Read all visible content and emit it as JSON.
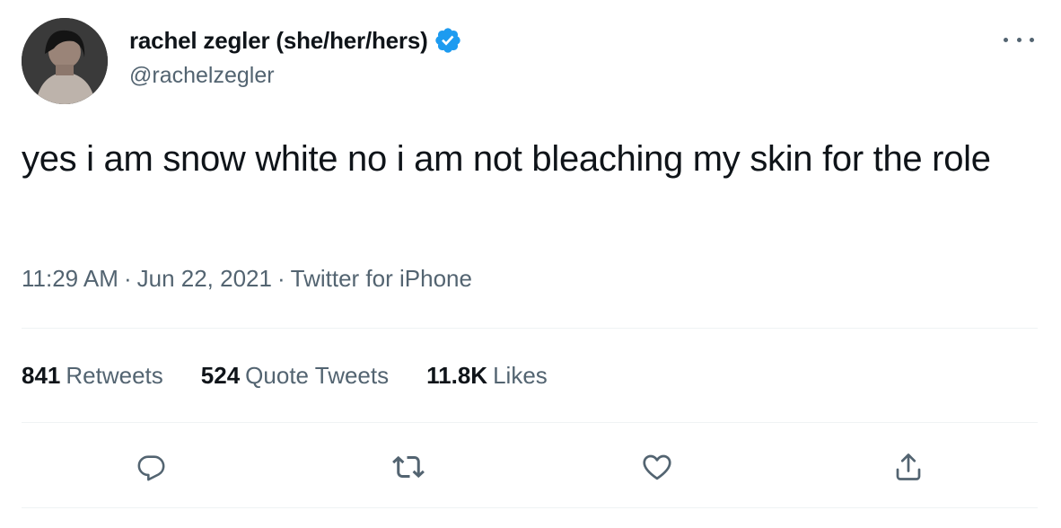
{
  "author": {
    "display_name": "rachel zegler (she/her/hers)",
    "handle": "@rachelzegler",
    "verified_icon": "verified-badge-icon",
    "avatar_icon": "avatar"
  },
  "menu": {
    "more_icon": "more-options-icon"
  },
  "tweet": {
    "text": "yes i am snow white no i am not bleaching my skin for the role"
  },
  "meta": {
    "time": "11:29 AM",
    "separator": "·",
    "date": "Jun 22, 2021",
    "source": "Twitter for iPhone"
  },
  "stats": {
    "retweets_count": "841",
    "retweets_label": "Retweets",
    "quotes_count": "524",
    "quotes_label": "Quote Tweets",
    "likes_count": "11.8K",
    "likes_label": "Likes"
  },
  "actions": {
    "reply_icon": "reply-icon",
    "retweet_icon": "retweet-icon",
    "like_icon": "heart-icon",
    "share_icon": "share-icon"
  },
  "colors": {
    "text_primary": "#0f1419",
    "text_secondary": "#536471",
    "verified_blue": "#1d9bf0",
    "divider": "#eff3f4"
  }
}
